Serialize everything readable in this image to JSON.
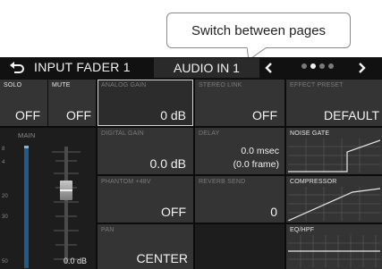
{
  "callout": {
    "text": "Switch between pages"
  },
  "header": {
    "title": "INPUT FADER 1",
    "page": "AUDIO IN 1",
    "page_dots": [
      false,
      true,
      false,
      false
    ]
  },
  "row1": {
    "solo": {
      "label": "SOLO",
      "value": "OFF"
    },
    "mute": {
      "label": "MUTE",
      "value": "OFF"
    },
    "analog_gain": {
      "label": "ANALOG GAIN",
      "value": "0 dB"
    },
    "stereo_link": {
      "label": "STEREO LINK",
      "value": "OFF"
    },
    "effect_preset": {
      "label": "EFFECT PRESET",
      "value": "DEFAULT"
    }
  },
  "fader": {
    "label": "MAIN",
    "value": "0.0 dB",
    "scale": [
      "8",
      "4",
      "20",
      "30",
      "50"
    ]
  },
  "params": {
    "digital_gain": {
      "label": "DIGITAL GAIN",
      "value": "0.0 dB"
    },
    "delay": {
      "label": "DELAY",
      "value": "0.0 msec",
      "value2": "(0.0 frame)"
    },
    "phantom": {
      "label": "PHANTOM +48V",
      "value": "OFF"
    },
    "reverb_send": {
      "label": "REVERB SEND",
      "value": "0"
    },
    "pan": {
      "label": "PAN",
      "value": "CENTER"
    }
  },
  "effects": {
    "noise_gate": "NOISE GATE",
    "compressor": "COMPRESSOR",
    "eq_hpf": "EQ/HPF"
  },
  "colors": {
    "screen_bg": "#0c0c0c",
    "cell_bg": "#343434",
    "meter_blue": "#1f5a8a",
    "text": "#f2f2f2"
  }
}
